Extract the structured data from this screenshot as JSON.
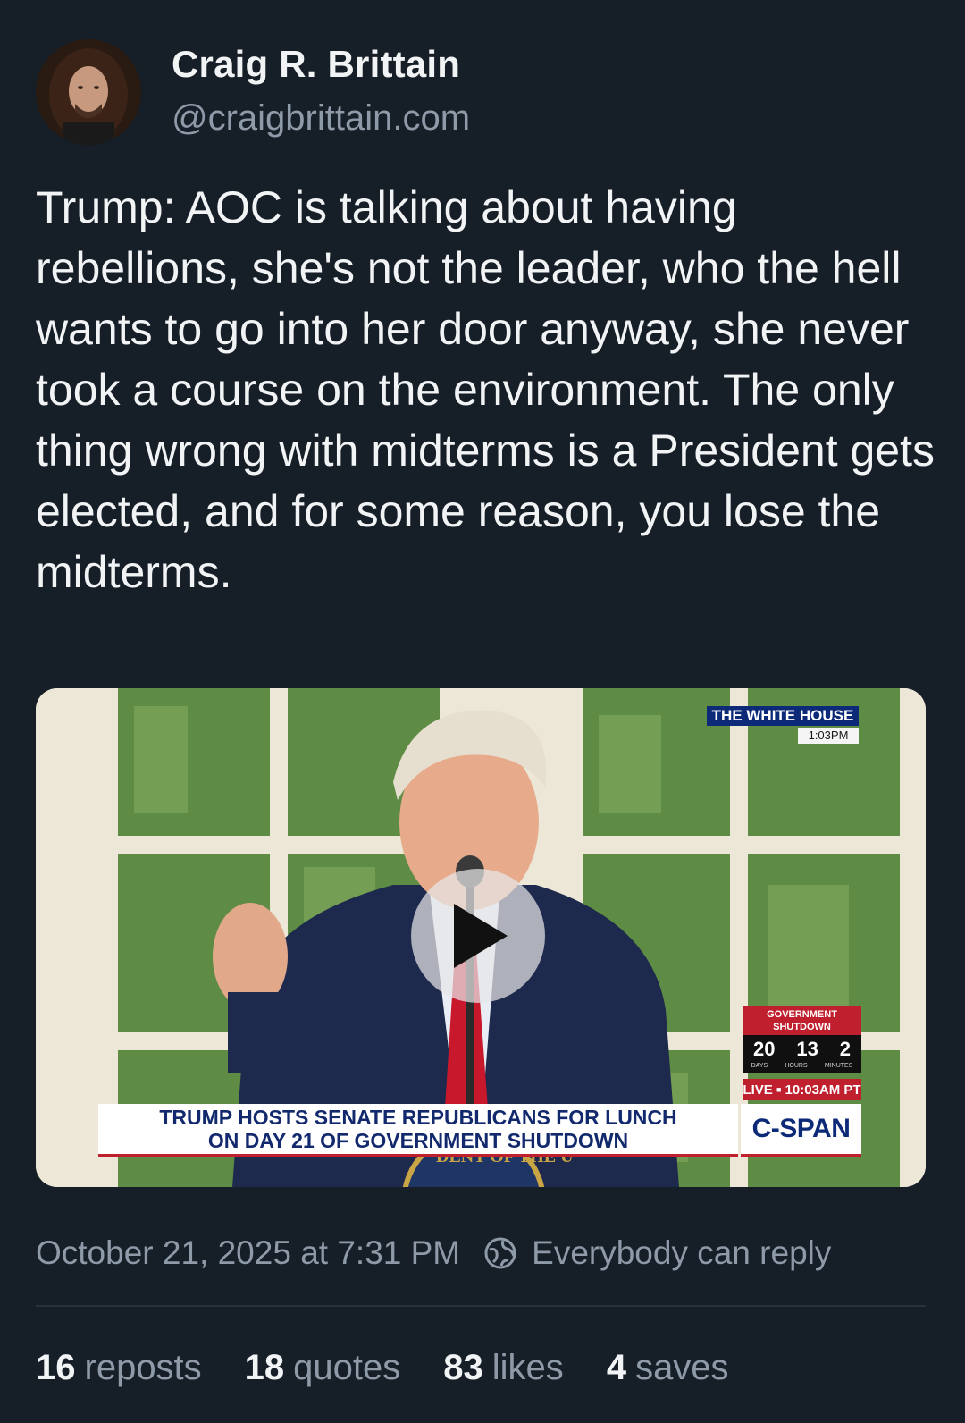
{
  "author": {
    "name": "Craig R. Brittain",
    "handle": "@craigbrittain.com",
    "avatar_icon": "profile-photo"
  },
  "post": {
    "text": "Trump: AOC is talking about having rebellions, she's not the leader, who the hell wants to go into her door anyway, she never took a course on the environment. The only thing wrong with midterms is a President gets elected, and for some reason, you lose the midterms."
  },
  "video": {
    "location_bug": "THE WHITE HOUSE",
    "location_time": "1:03PM",
    "shutdown_label": "GOVERNMENT SHUTDOWN",
    "shutdown_days": "20",
    "shutdown_hours": "13",
    "shutdown_minutes": "2",
    "unit_days": "DAYS",
    "unit_hours": "HOURS",
    "unit_minutes": "MINUTES",
    "live_label": "LIVE",
    "live_time": "10:03AM PT",
    "headline_line1": "TRUMP HOSTS SENATE REPUBLICANS FOR LUNCH",
    "headline_line2": "ON DAY 21 OF GOVERNMENT SHUTDOWN",
    "network": "C-SPAN",
    "seal_text": "DENT OF THE U",
    "play_icon": "play-icon",
    "brand_colors": {
      "cspan_blue": "#0d2a78",
      "cspan_red": "#c0202e"
    }
  },
  "meta": {
    "timestamp": "October 21, 2025 at 7:31 PM",
    "reply_setting": "Everybody can reply",
    "reply_icon": "globe-icon"
  },
  "stats": {
    "reposts_count": "16",
    "reposts_label": "reposts",
    "quotes_count": "18",
    "quotes_label": "quotes",
    "likes_count": "83",
    "likes_label": "likes",
    "saves_count": "4",
    "saves_label": "saves"
  },
  "colors": {
    "background": "#161e27",
    "text_primary": "#f1f3f5",
    "text_secondary": "#8f9aa8"
  }
}
